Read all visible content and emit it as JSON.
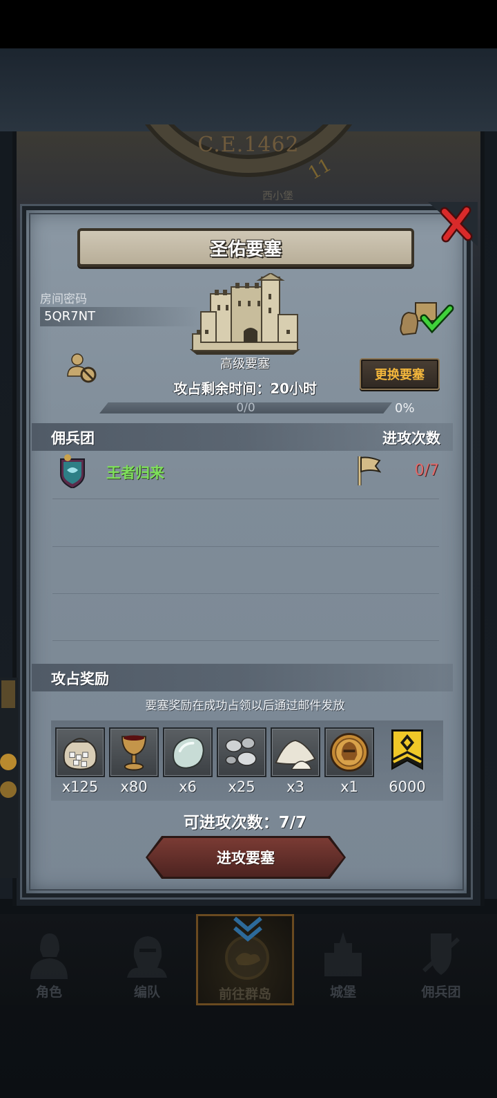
{
  "world": {
    "year": "C.E.1462",
    "map_label": "西小堡",
    "hour": "11"
  },
  "modal": {
    "title": "圣佑要塞",
    "room_label": "房间密码",
    "room_code": "5QR7NT",
    "fort_level": "高级要塞",
    "remaining_time": "攻占剩余时间：20小时",
    "change_button": "更换要塞",
    "progress": {
      "text": "0/0",
      "percent_text": "0%",
      "fraction": 0
    },
    "mercenary_header": "佣兵团",
    "attacks_header": "进攻次数",
    "rows": [
      {
        "name": "王者归来",
        "count": "0/7"
      }
    ],
    "reward_header": "攻占奖励",
    "reward_note": "要塞奖励在成功占领以后通过邮件发放",
    "rewards": [
      {
        "icon": "silver-ore-sack-icon",
        "qty": "x125"
      },
      {
        "icon": "goblet-icon",
        "qty": "x80"
      },
      {
        "icon": "moonstone-icon",
        "qty": "x6"
      },
      {
        "icon": "silver-pearls-icon",
        "qty": "x25"
      },
      {
        "icon": "salt-pile-icon",
        "qty": "x3"
      },
      {
        "icon": "golden-helmet-coin-icon",
        "qty": "x1"
      },
      {
        "icon": "honor-banner-icon",
        "qty": "6000"
      }
    ],
    "attacks_available": "可进攻次数：7/7",
    "attack_button": "进攻要塞"
  },
  "nav": {
    "items": [
      {
        "label": "角色",
        "icon": "knight-bust-icon"
      },
      {
        "label": "编队",
        "icon": "helmet-squad-icon"
      },
      {
        "label": "前往群岛",
        "icon": "island-compass-icon"
      },
      {
        "label": "城堡",
        "icon": "castle-icon"
      },
      {
        "label": "佣兵团",
        "icon": "mercenary-icon"
      }
    ]
  },
  "colors": {
    "accent_gold": "#f2b63c",
    "guild_green": "#7ee05a",
    "count_red": "#e36a6a",
    "panel": "#8b98a4"
  }
}
